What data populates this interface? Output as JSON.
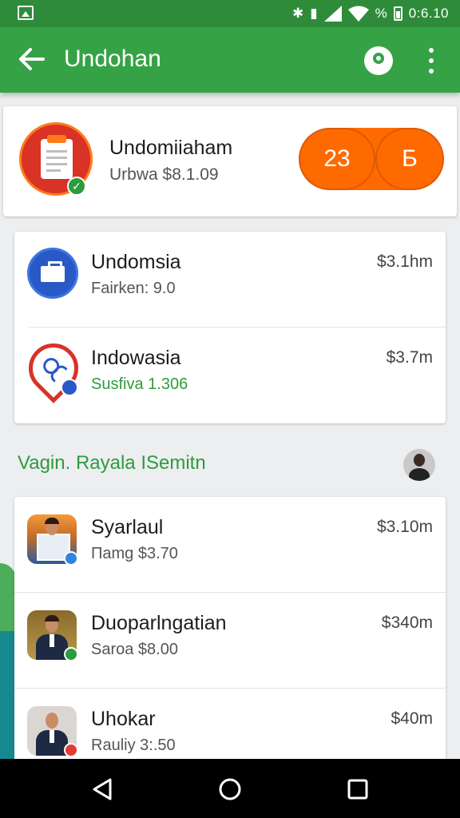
{
  "status_bar": {
    "signal_glyphs": "✱ ⬡",
    "battery_text": "%",
    "time": "0:6.10"
  },
  "app_bar": {
    "title": "Undohan",
    "back_icon": "arrow-left-icon",
    "account_icon": "account-location-icon",
    "menu_icon": "more-vert-icon"
  },
  "summary": {
    "name": "Undomiiaham",
    "subtitle": "Urbwa $8.1.09",
    "pill_left": "23",
    "pill_right": "Б",
    "accent_color": "#ff6a00"
  },
  "accounts": [
    {
      "title": "Undomsia",
      "subtitle": "Fairken: 9.0",
      "amount": "$3.1hm",
      "icon": "briefcase-icon"
    },
    {
      "title": "Indowasia",
      "subtitle": "Susfiva 1.306",
      "amount": "$3.7m",
      "icon": "location-pin-icon"
    }
  ],
  "section": {
    "title": "Vagin. Rayala ISemitn"
  },
  "contacts": [
    {
      "title": "Syarlaul",
      "subtitle": "Пamg $3.70",
      "amount": "$3.10m"
    },
    {
      "title": "Duoparlngatian",
      "subtitle": "Saroa $8.00",
      "amount": "$340m"
    },
    {
      "title": "Uhokar",
      "subtitle": "Rauliy 3:.50",
      "amount": "$40m"
    }
  ],
  "colors": {
    "status_bar": "#2e8b3a",
    "app_bar": "#36a246",
    "section_title": "#2e9b3c"
  }
}
